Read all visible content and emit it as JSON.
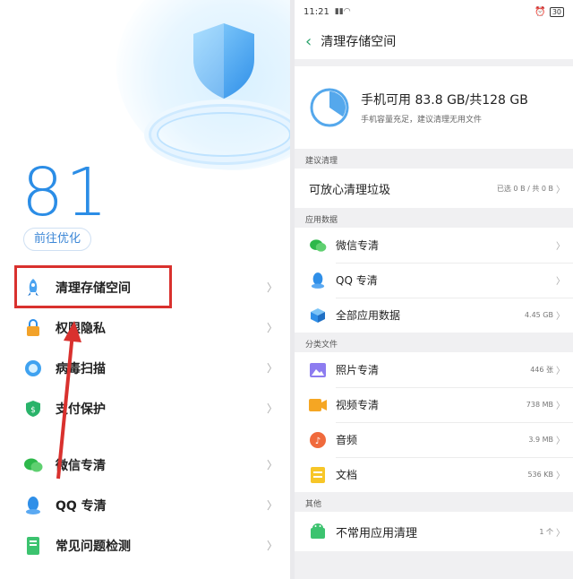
{
  "left": {
    "score": "81",
    "optimize_button": "前往优化",
    "menu": [
      {
        "label": "清理存储空间",
        "icon": "rocket-icon"
      },
      {
        "label": "权限隐私",
        "icon": "lock-icon"
      },
      {
        "label": "病毒扫描",
        "icon": "scan-icon"
      },
      {
        "label": "支付保护",
        "icon": "payment-shield-icon"
      },
      {
        "label": "微信专清",
        "icon": "wechat-icon"
      },
      {
        "label": "QQ 专清",
        "icon": "qq-icon"
      },
      {
        "label": "常见问题检测",
        "icon": "phone-check-icon"
      }
    ],
    "chevron": "〉"
  },
  "right": {
    "status": {
      "time": "11:21",
      "battery": "30"
    },
    "title": "清理存储空间",
    "storage": {
      "main": "手机可用 83.8 GB/共128 GB",
      "sub": "手机容量充足，建议清理无用文件",
      "used_fraction": 0.345
    },
    "sections": {
      "suggest": {
        "title": "建议清理",
        "row": {
          "label": "可放心清理垃圾",
          "value": "已选 0 B / 共 0 B"
        }
      },
      "app_data": {
        "title": "应用数据",
        "rows": [
          {
            "label": "微信专清",
            "value": ""
          },
          {
            "label": "QQ 专清",
            "value": ""
          },
          {
            "label": "全部应用数据",
            "value": "4.45 GB"
          }
        ]
      },
      "files": {
        "title": "分类文件",
        "rows": [
          {
            "label": "照片专清",
            "value": "446 张"
          },
          {
            "label": "视频专清",
            "value": "738 MB"
          },
          {
            "label": "音频",
            "value": "3.9 MB"
          },
          {
            "label": "文档",
            "value": "536 KB"
          }
        ]
      },
      "other": {
        "title": "其他",
        "rows": [
          {
            "label": "不常用应用清理",
            "value": "1 个"
          }
        ]
      }
    },
    "chevron": "〉"
  },
  "colors": {
    "accent": "#2b8de6",
    "highlight": "#d9312e",
    "green": "#2aa36b"
  }
}
